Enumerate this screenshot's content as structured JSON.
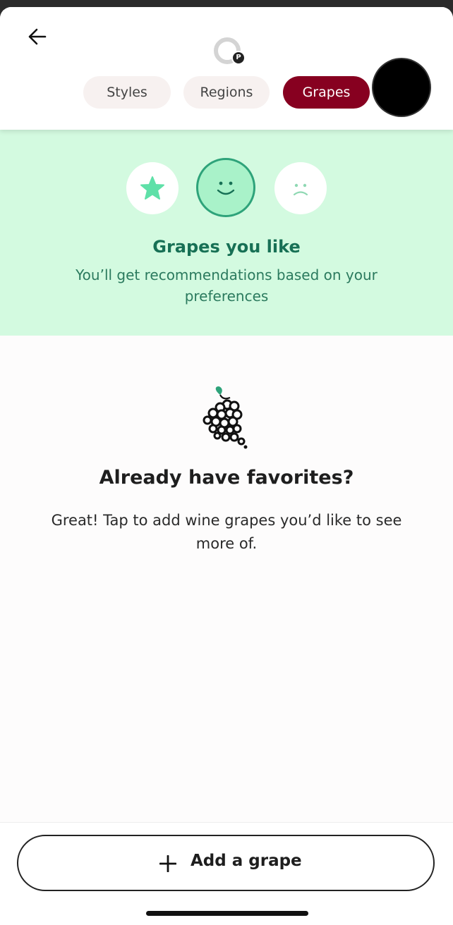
{
  "header": {
    "tabs": [
      {
        "label": "Styles",
        "active": false
      },
      {
        "label": "Regions",
        "active": false
      },
      {
        "label": "Grapes",
        "active": true
      }
    ],
    "avatar_badge": "P"
  },
  "hero": {
    "options": [
      "star-icon",
      "smile-icon",
      "frown-icon"
    ],
    "selected": "smile-icon",
    "title": "Grapes you like",
    "subtitle": "You’ll get recommendations based on your preferences"
  },
  "empty_state": {
    "icon": "grape-icon",
    "title": "Already have favorites?",
    "description": "Great! Tap to add wine grapes you’d like to see more of."
  },
  "footer": {
    "add_button_label": "Add a grape"
  },
  "colors": {
    "accent": "#870020",
    "hero_bg": "#d3fae0",
    "hero_text": "#177055",
    "star": "#5fe0a8"
  }
}
